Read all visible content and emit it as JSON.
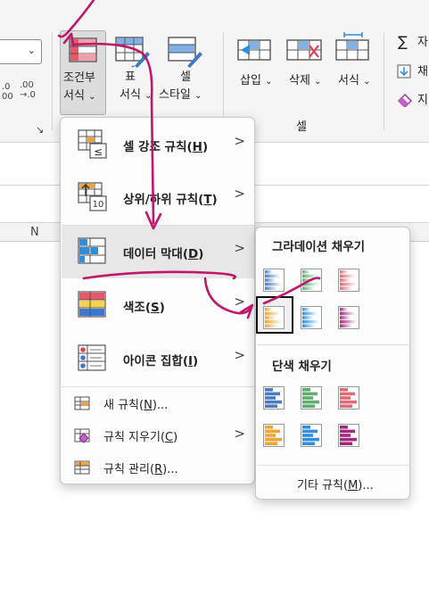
{
  "ribbon": {
    "number_format_left": ".0",
    "decimal_increase": ".00\n.0",
    "decimal_decrease": ".00\n→.0",
    "cond_format": {
      "line1": "조건부",
      "line2": "서식",
      "chev": "⌄"
    },
    "table_format": {
      "line1": "표",
      "line2": "서식",
      "chev": "⌄"
    },
    "cell_style": {
      "line1": "셀",
      "line2": "스타일",
      "chev": "⌄"
    },
    "insert": {
      "label": "삽입",
      "chev": "⌄"
    },
    "delete": {
      "label": "삭제",
      "chev": "⌄"
    },
    "format": {
      "label": "서식",
      "chev": "⌄"
    },
    "cells_group_label": "셀",
    "autosum_glyph": "∑",
    "side_items": [
      "자",
      "채",
      "지"
    ]
  },
  "sheet": {
    "column_letter": "N"
  },
  "menu": {
    "items": [
      {
        "label": "셀 강조 규칙",
        "key": "H",
        "icon": "highlight-cells-rules-icon"
      },
      {
        "label": "상위/하위 규칙",
        "key": "T",
        "icon": "top-bottom-rules-icon"
      },
      {
        "label": "데이터 막대",
        "key": "D",
        "icon": "data-bars-icon"
      },
      {
        "label": "색조",
        "key": "S",
        "icon": "color-scales-icon"
      },
      {
        "label": "아이콘 집합",
        "key": "I",
        "icon": "icon-sets-icon"
      }
    ],
    "small_items": [
      {
        "label": "새 규칙",
        "key": "N",
        "suffix": "...",
        "icon": "new-rule-icon"
      },
      {
        "label": "규칙 지우기",
        "key": "C",
        "suffix": "",
        "icon": "clear-rules-icon"
      },
      {
        "label": "규칙 관리",
        "key": "R",
        "suffix": "...",
        "icon": "manage-rules-icon"
      }
    ],
    "arrow": ">",
    "icon_text_lt": "≤",
    "icon_text_10": "10"
  },
  "submenu": {
    "gradient_heading": "그라데이션 채우기",
    "solid_heading": "단색 채우기",
    "more_rules": "기타 규칙",
    "more_key": "M",
    "more_suffix": "...",
    "colors": {
      "blue": "#4a7cc4",
      "green": "#5fae6e",
      "red": "#e06a78",
      "orange": "#f0a432",
      "lightblue": "#2e8fe0",
      "purple": "#a4287c"
    }
  },
  "colors": {
    "ribbon_bg": "#f5f5f5",
    "menu_bg": "#fcfcfc",
    "menu_highlight": "#e7e7e7",
    "annotation_ink": "#c0166b"
  }
}
